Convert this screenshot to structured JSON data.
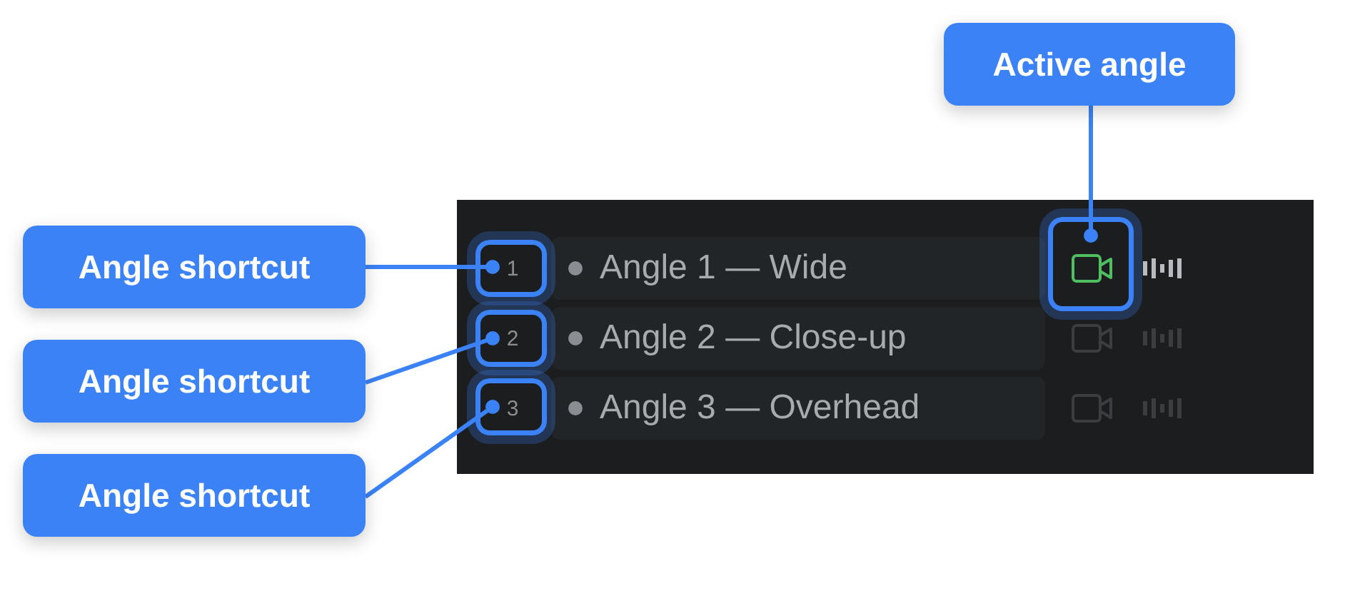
{
  "angles": [
    {
      "shortcut": "1",
      "label": "Angle 1 — Wide",
      "selected": true
    },
    {
      "shortcut": "2",
      "label": "Angle 2 — Close-up",
      "selected": false
    },
    {
      "shortcut": "3",
      "label": "Angle 3 — Overhead",
      "selected": false
    }
  ],
  "callouts": [
    {
      "text": "Active angle"
    },
    {
      "text": "Angle shortcut"
    },
    {
      "text": "Angle shortcut"
    },
    {
      "text": "Angle shortcut"
    }
  ]
}
